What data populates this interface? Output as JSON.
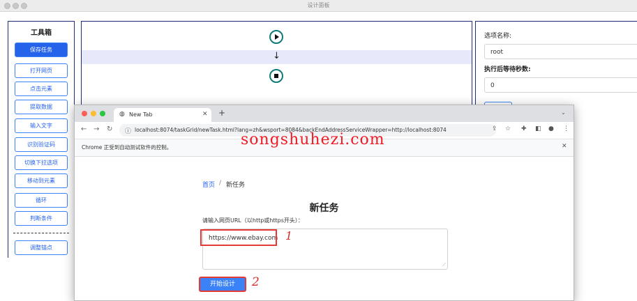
{
  "window": {
    "title": "设计面板"
  },
  "toolbox": {
    "title": "工具箱",
    "items": [
      "保存任务",
      "打开网页",
      "点击元素",
      "提取数据",
      "输入文字",
      "识别验证码",
      "切换下拉选项",
      "移动到元素",
      "循环",
      "判断条件"
    ],
    "extra_item": "调整锚点",
    "active_index": 0
  },
  "flow": {
    "start_icon": "play-icon",
    "stop_icon": "stop-icon",
    "arrow": "↓"
  },
  "options": {
    "name_label": "选项名称:",
    "name_value": "root",
    "wait_label": "执行后等待秒数:",
    "wait_value": "0"
  },
  "browser": {
    "tab_title": "New Tab",
    "new_tab": "+",
    "url": "localhost:8074/taskGrid/newTask.html?lang=zh&wsport=8084&backEndAddressServiceWrapper=http://localhost:8074",
    "info_message": "Chrome 正受到自动测试软件的控制。",
    "watermark": "songshuhezi.com"
  },
  "page": {
    "breadcrumb_home": "首页",
    "breadcrumb_sep": "/",
    "breadcrumb_current": "新任务",
    "title": "新任务",
    "url_label": "请输入网页URL（以http或https开头）：",
    "url_value": "https://www.ebay.com",
    "start_button": "开始设计",
    "annotation_1": "1",
    "annotation_2": "2"
  },
  "colors": {
    "accent": "#2563eb",
    "panel_border": "#1a2b7a",
    "flow_node": "#117a7a",
    "highlight": "#e53935"
  }
}
